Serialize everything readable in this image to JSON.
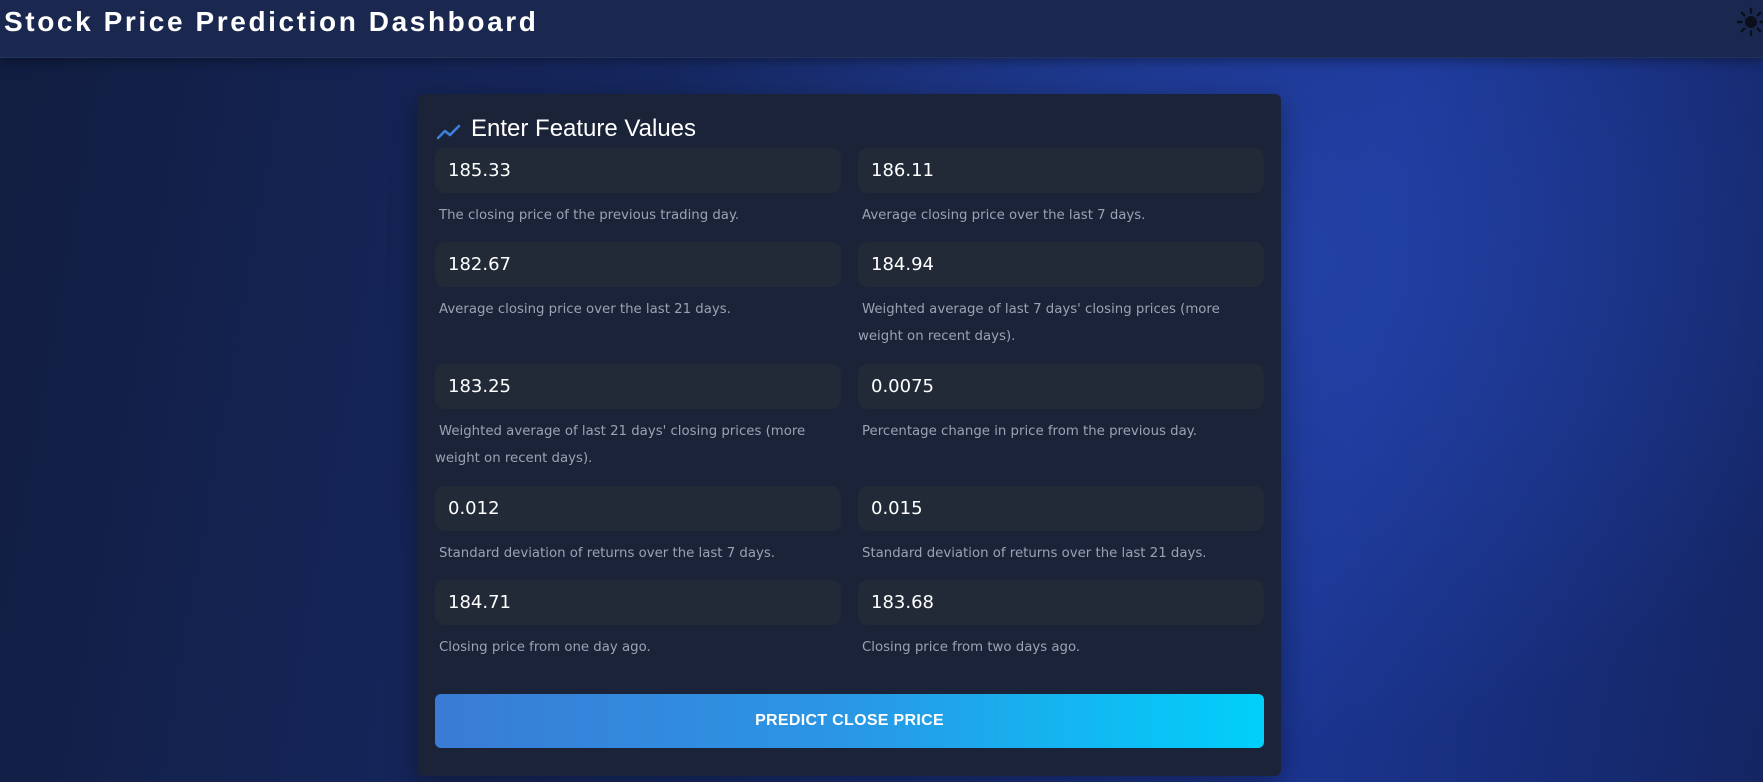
{
  "header": {
    "title": "Stock Price Prediction Dashboard",
    "theme_icon": "sun-icon"
  },
  "form": {
    "title": "Enter Feature Values",
    "title_icon": "trending-chart-icon",
    "fields": [
      {
        "value": "185.33",
        "help": "The closing price of the previous trading day."
      },
      {
        "value": "186.11",
        "help": "Average closing price over the last 7 days."
      },
      {
        "value": "182.67",
        "help": "Average closing price over the last 21 days."
      },
      {
        "value": "184.94",
        "help": "Weighted average of last 7 days' closing prices (more weight on recent days)."
      },
      {
        "value": "183.25",
        "help": "Weighted average of last 21 days' closing prices (more weight on recent days)."
      },
      {
        "value": "0.0075",
        "help": "Percentage change in price from the previous day."
      },
      {
        "value": "0.012",
        "help": "Standard deviation of returns over the last 7 days."
      },
      {
        "value": "0.015",
        "help": "Standard deviation of returns over the last 21 days."
      },
      {
        "value": "184.71",
        "help": "Closing price from one day ago."
      },
      {
        "value": "183.68",
        "help": "Closing price from two days ago."
      }
    ],
    "submit_label": "PREDICT CLOSE PRICE"
  },
  "colors": {
    "accent": "#3a7bd6",
    "accent_end": "#00d0fb",
    "card_bg": "#1b2338",
    "input_bg": "#222a38",
    "header_bg": "#1a2850"
  }
}
